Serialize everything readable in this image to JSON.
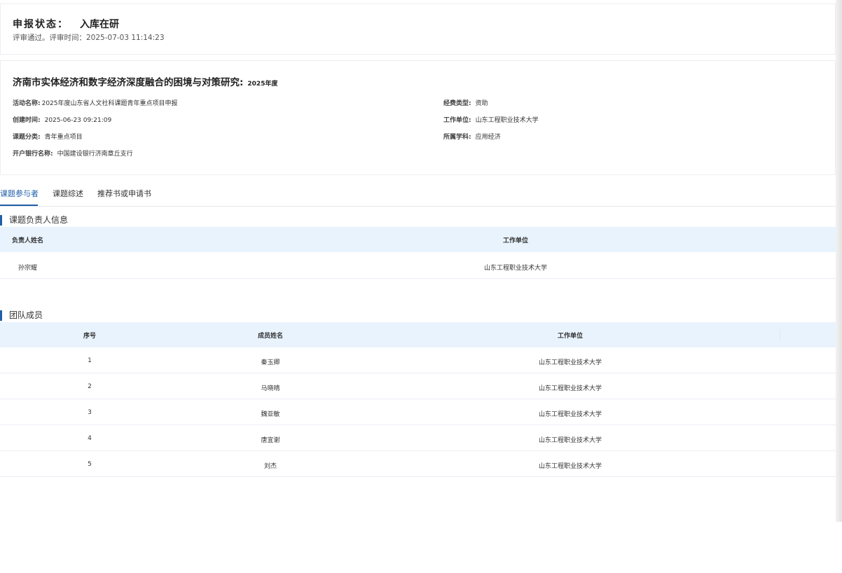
{
  "status": {
    "label": "申报状态：",
    "value": "入库在研",
    "sub": "评审通过。评审时间：2025-07-03 11:14:23"
  },
  "project": {
    "title": "济南市实体经济和数字经济深度融合的困境与对策研究:",
    "year": "2025年度",
    "fields": {
      "activity_label": "活动名称:",
      "activity_value": "2025年度山东省人文社科课题青年重点项目申报",
      "created_label": "创建时间:",
      "created_value": "2025-06-23 09:21:09",
      "category_label": "课题分类:",
      "category_value": "青年重点项目",
      "bank_label": "开户银行名称:",
      "bank_value": "中国建设银行济南章丘支行",
      "funding_label": "经费类型:",
      "funding_value": "资助",
      "unit_label": "工作单位:",
      "unit_value": "山东工程职业技术大学",
      "discipline_label": "所属学科:",
      "discipline_value": "应用经济"
    }
  },
  "tabs": [
    {
      "label": "课题参与者"
    },
    {
      "label": "课题综述"
    },
    {
      "label": "推荐书或申请书"
    }
  ],
  "leader_section": {
    "title": "课题负责人信息",
    "columns": [
      "负责人姓名",
      "工作单位"
    ],
    "rows": [
      {
        "name": "孙宗耀",
        "unit": "山东工程职业技术大学"
      }
    ]
  },
  "team_section": {
    "title": "团队成员",
    "columns": [
      "序号",
      "成员姓名",
      "工作单位"
    ],
    "rows": [
      {
        "no": "1",
        "name": "秦玉卿",
        "unit": "山东工程职业技术大学"
      },
      {
        "no": "2",
        "name": "马晓晴",
        "unit": "山东工程职业技术大学"
      },
      {
        "no": "3",
        "name": "魏亚敏",
        "unit": "山东工程职业技术大学"
      },
      {
        "no": "4",
        "name": "唐宜谢",
        "unit": "山东工程职业技术大学"
      },
      {
        "no": "5",
        "name": "刘杰",
        "unit": "山东工程职业技术大学"
      }
    ]
  },
  "colors": {
    "accent": "#1f5fa8",
    "table_header_bg": "#e8f3fe",
    "border": "#eceef2"
  }
}
